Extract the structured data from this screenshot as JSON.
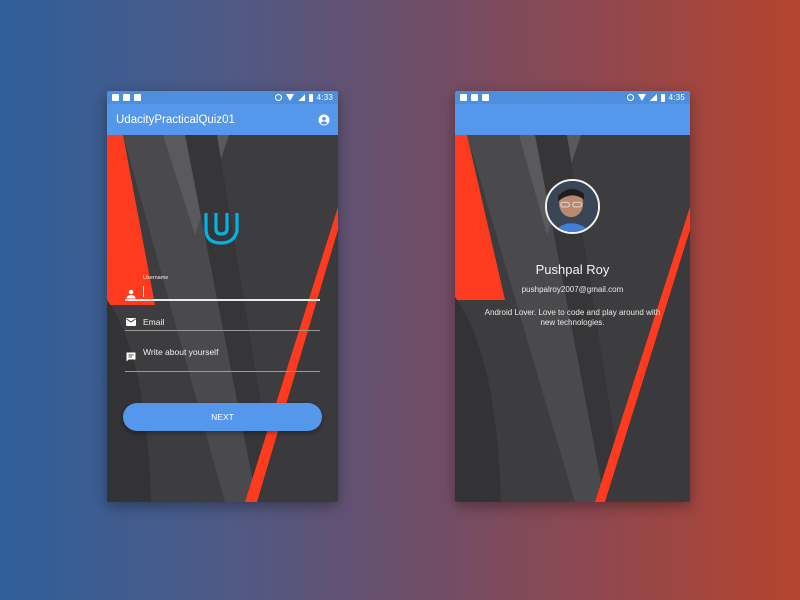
{
  "colors": {
    "accent": "#5597ea",
    "statusbar": "#4d8fdc",
    "background_dark": "#3d3d3f",
    "stripe_red": "#ff3b1f",
    "udacity_blue": "#02b3e4"
  },
  "left_screen": {
    "statusbar": {
      "icons": [
        "facebook-icon",
        "photos-icon",
        "notification-n-icon"
      ],
      "status_icons": [
        "vibrate-icon",
        "wifi-icon",
        "signal-icon",
        "battery-icon"
      ],
      "time": "4:33"
    },
    "appbar": {
      "title": "UdacityPracticalQuiz01",
      "account_icon": "account-circle-icon"
    },
    "logo": "udacity-logo",
    "form": {
      "username": {
        "label": "Username",
        "value": "",
        "icon": "person-icon"
      },
      "email": {
        "placeholder": "Email",
        "icon": "mail-icon"
      },
      "about": {
        "placeholder": "Write about yourself",
        "icon": "chat-icon"
      }
    },
    "next_button": "NEXT"
  },
  "right_screen": {
    "statusbar": {
      "icons": [
        "facebook-icon",
        "photos-icon",
        "notification-n-icon"
      ],
      "status_icons": [
        "vibrate-icon",
        "wifi-icon",
        "signal-icon",
        "battery-icon"
      ],
      "time": "4:35"
    },
    "profile": {
      "name": "Pushpal Roy",
      "email": "pushpalroy2007@gmail.com",
      "bio": "Android Lover. Love to code and play around with new technologies."
    }
  }
}
